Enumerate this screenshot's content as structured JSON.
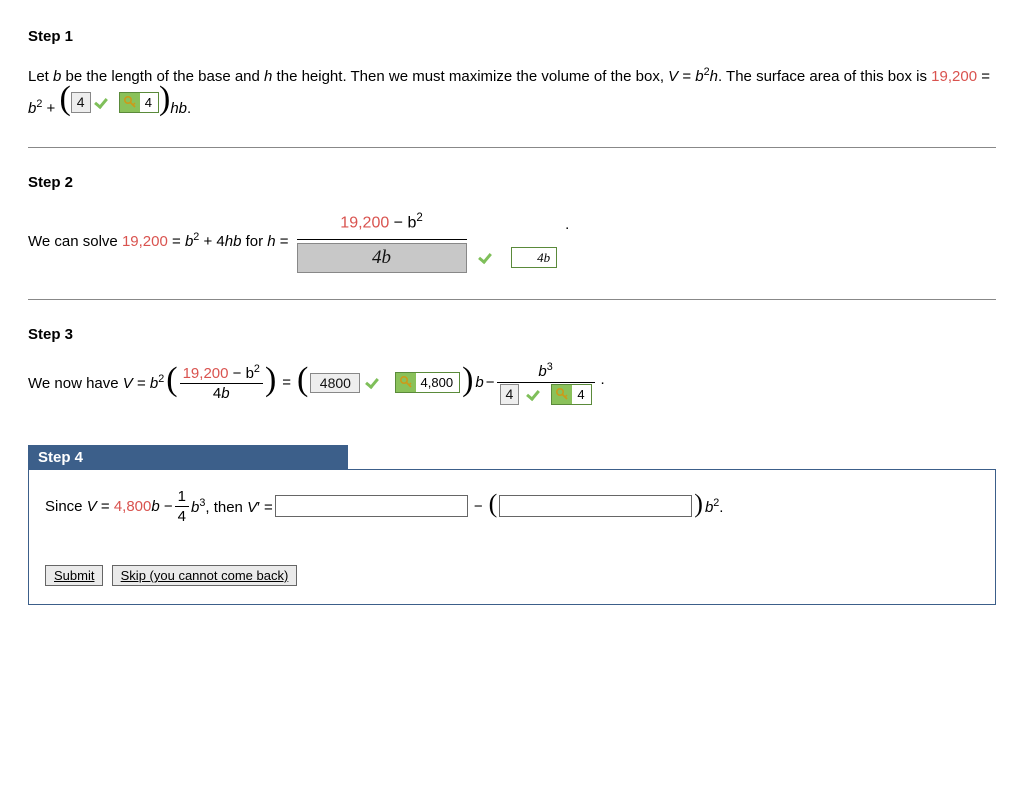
{
  "step1": {
    "title": "Step 1",
    "text_a": "Let ",
    "text_b_var": "b",
    "text_c": " be the length of the base and ",
    "text_h_var": "h",
    "text_d": " the height. Then we must maximize the volume of the box, ",
    "text_V_var": "V",
    "text_e": " = ",
    "text_f": "b",
    "sup_2": "2",
    "text_g": "h",
    "text_h": ". The surface area of this box is ",
    "sa_value": "19,200",
    "text_i": " = ",
    "text_j": "b",
    "text_k": " + ",
    "input1": "4",
    "key1": "4",
    "text_l": "hb",
    "text_m": "."
  },
  "step2": {
    "title": "Step 2",
    "text_a": "We can solve ",
    "sa_value": "19,200",
    "text_b": " = ",
    "bsq": "b",
    "exp2": "2",
    "text_c": " + 4",
    "hb": "hb",
    "text_d": " for ",
    "h_var": "h",
    "text_e": " = ",
    "frac_num_a": "19,200",
    "frac_num_b": " − b",
    "frac_den_input": "4b",
    "key2": "4b",
    "dot": "."
  },
  "step3": {
    "title": "Step 3",
    "text_a": "We now have ",
    "V_var": "V",
    "text_b": " = ",
    "b_var": "b",
    "exp2": "2",
    "frac_num_a": "19,200",
    "frac_num_b": " − b",
    "frac_den": "4b",
    "text_c": " = ",
    "input1": "4800",
    "key1": "4,800",
    "b_mid": "b",
    "minus": " − ",
    "frac2_num_b": "b",
    "frac2_num_exp": "3",
    "frac2_den_input": "4",
    "key2": "4",
    "dot": "."
  },
  "step4": {
    "title": "Step 4",
    "text_a": "Since ",
    "V_var": "V",
    "text_b": " = ",
    "val": "4,800",
    "b_var": "b",
    "minus": " − ",
    "frac_num": "1",
    "frac_den": "4",
    "b3_var": "b",
    "b3_exp": "3",
    "text_c": ", then ",
    "Vp_var": "V",
    "prime": "′",
    "text_d": " = ",
    "mid_minus": " − ",
    "b2_var": "b",
    "b2_exp": "2",
    "dot": ".",
    "submit": "Submit",
    "skip": "Skip (you cannot come back)"
  }
}
